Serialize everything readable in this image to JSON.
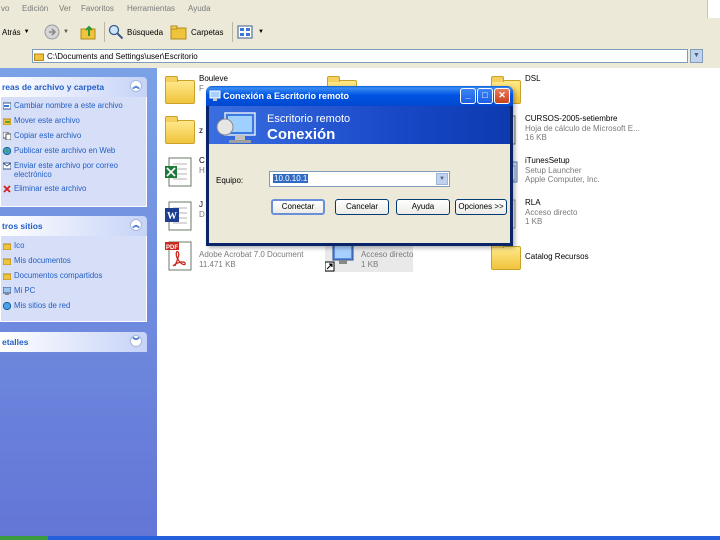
{
  "menu": [
    "vo",
    "Edición",
    "Ver",
    "Favoritos",
    "Herramientas",
    "Ayuda"
  ],
  "toolbar": {
    "back_label": "Atrás",
    "search_label": "Búsqueda",
    "folders_label": "Carpetas"
  },
  "address": {
    "path": "C:\\Documents and Settings\\user\\Escritorio"
  },
  "taskpane": {
    "file_tasks": {
      "title": "reas de archivo y carpeta",
      "items": [
        "Cambiar nombre a este archivo",
        "Mover este archivo",
        "Copiar este archivo",
        "Publicar este archivo en Web",
        "Enviar este archivo por correo electrónico",
        "Eliminar este archivo"
      ]
    },
    "other_places": {
      "title": "tros sitios",
      "items": [
        "Ico",
        "Mis documentos",
        "Documentos compartidos",
        "Mi PC",
        "Mis sitios de red"
      ]
    },
    "details": {
      "title": "etalles"
    }
  },
  "files": [
    {
      "line1": "Bouleve",
      "line2": "F",
      "line3": ""
    },
    {
      "line1": "",
      "line2": "",
      "line3": ""
    },
    {
      "line1": "DSL",
      "line2": "",
      "line3": ""
    },
    {
      "line1": "z",
      "line2": "",
      "line3": ""
    },
    {
      "line1": "",
      "line2": "",
      "line3": ""
    },
    {
      "line1": "CURSOS-2005-setiembre",
      "line2": "Hoja de cálculo de Microsoft E...",
      "line3": "16 KB"
    },
    {
      "line1": "C",
      "line2": "H",
      "line3": ""
    },
    {
      "line1": "iTunesSetup",
      "line2": "Setup Launcher",
      "line3": "Apple Computer, Inc."
    },
    {
      "line1": "J",
      "line2": "D",
      "line3": ""
    },
    {
      "line1": "RLA",
      "line2": "Acceso directo",
      "line3": "1 KB"
    },
    {
      "line1": "",
      "line2": "Adobe Acrobat 7.0 Document",
      "line3": "11.471 KB"
    },
    {
      "line1": "",
      "line2": "Acceso directo",
      "line3": "1 KB"
    },
    {
      "line1": "Catalog Recursos",
      "line2": "",
      "line3": ""
    }
  ],
  "dialog": {
    "title": "Conexión a Escritorio remoto",
    "banner_line1": "Escritorio remoto",
    "banner_line2": "Conexión",
    "equipo_label": "Equipo:",
    "equipo_value": "10.0.10.1",
    "buttons": {
      "connect": "Conectar",
      "cancel": "Cancelar",
      "help": "Ayuda",
      "options": "Opciones >>"
    }
  },
  "colors": {
    "xp_blue": "#0054e3",
    "pane_blue": "#7ba2e7",
    "link_blue": "#215dc6",
    "dialog_bg": "#ece9d8"
  }
}
